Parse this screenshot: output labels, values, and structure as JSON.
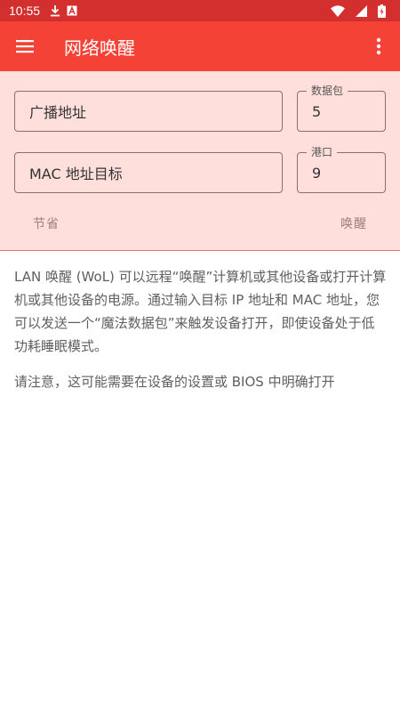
{
  "status_bar": {
    "time": "10:55",
    "icons": [
      "download-icon",
      "font-icon",
      "wifi-icon",
      "signal-icon",
      "battery-charging-icon"
    ]
  },
  "app_bar": {
    "title": "网络唤醒",
    "menu_icon": "hamburger-menu-icon",
    "more_icon": "more-vertical-icon"
  },
  "form": {
    "broadcast_address": {
      "placeholder": "广播地址"
    },
    "packets": {
      "label": "数据包",
      "value": "5"
    },
    "mac_address": {
      "placeholder": "MAC 地址目标"
    },
    "port": {
      "label": "港口",
      "value": "9"
    },
    "save_label": "节省",
    "wake_label": "唤醒"
  },
  "description": {
    "paragraph1": "LAN 唤醒 (WoL) 可以远程“唤醒”计算机或其他设备或打开计算机或其他设备的电源。通过输入目标 IP 地址和 MAC 地址，您可以发送一个“魔法数据包”来触发设备打开，即使设备处于低功耗睡眠模式。",
    "paragraph2": "请注意，这可能需要在设备的设置或 BIOS 中明确打开"
  },
  "colors": {
    "status_bar": "#d32f2f",
    "app_bar": "#f44336",
    "form_background": "#ffdfdc"
  }
}
